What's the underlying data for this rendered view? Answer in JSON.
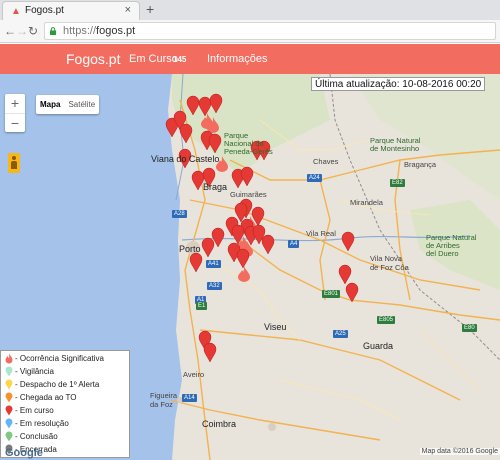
{
  "browser": {
    "tab_title": "Fogos.pt",
    "tab_close": "×",
    "new_tab": "+",
    "back": "←",
    "forward": "→",
    "reload": "↻",
    "info": "ⓘ",
    "url_scheme": "https://",
    "url_host": "fogos.pt"
  },
  "header": {
    "brand": "Fogos.pt",
    "nav_em_curso": "Em Curso",
    "em_curso_count": "145",
    "nav_informacoes": "Informações",
    "accent_color": "#f36c60"
  },
  "map": {
    "last_update": "Última atualização: 10-08-2016 00:20",
    "zoom_in": "+",
    "zoom_out": "−",
    "type_map": "Mapa",
    "type_satellite": "Satélite",
    "labels": {
      "viana": "Viana do\nCastelo",
      "braga": "Braga",
      "guimaraes": "Guimarães",
      "porto": "Porto",
      "vila_real": "Vila Real",
      "chaves": "Chaves",
      "braganca": "Bragança",
      "mirandela": "Mirandela",
      "viseu": "Viseu",
      "guarda": "Guarda",
      "coimbra": "Coimbra",
      "figueira": "Figueira\nda Foz",
      "vila_nova_foz_coa": "Vila Nova\nde Foz Côa",
      "aveiro": "Aveiro",
      "pn_geres": "Parque\nNacional da\nPeneda-Gerês",
      "pn_montesinho": "Parque Natural\nde Montesinho",
      "pn_arribes": "Parque Natural\nde Arribes\ndel Duero"
    },
    "road_shields": [
      "A28",
      "A24",
      "A4",
      "A41",
      "A32",
      "A1",
      "A25",
      "A14",
      "E1",
      "E80",
      "E801",
      "E82",
      "E805"
    ],
    "google": "Google",
    "attribution": "Map data ©2016 Google"
  },
  "legend": {
    "items": [
      {
        "label": "- Ocorrência Significativa",
        "color": "#f36c60",
        "icon": "flame-icon"
      },
      {
        "label": "- Vigilância",
        "color": "#a8e6cf",
        "icon": "pin-icon"
      },
      {
        "label": "- Despacho de 1º Alerta",
        "color": "#ffd54f",
        "icon": "pin-icon"
      },
      {
        "label": "- Chegada ao TO",
        "color": "#f5922f",
        "icon": "pin-icon"
      },
      {
        "label": "- Em curso",
        "color": "#e53935",
        "icon": "pin-icon"
      },
      {
        "label": "- Em resolução",
        "color": "#64b5f6",
        "icon": "pin-icon"
      },
      {
        "label": "- Conclusão",
        "color": "#81c784",
        "icon": "pin-icon"
      },
      {
        "label": "- Encerrada",
        "color": "#7b7b7b",
        "icon": "pin-icon"
      }
    ]
  },
  "pin_color": "#e53935",
  "flame_color": "#f36c60"
}
